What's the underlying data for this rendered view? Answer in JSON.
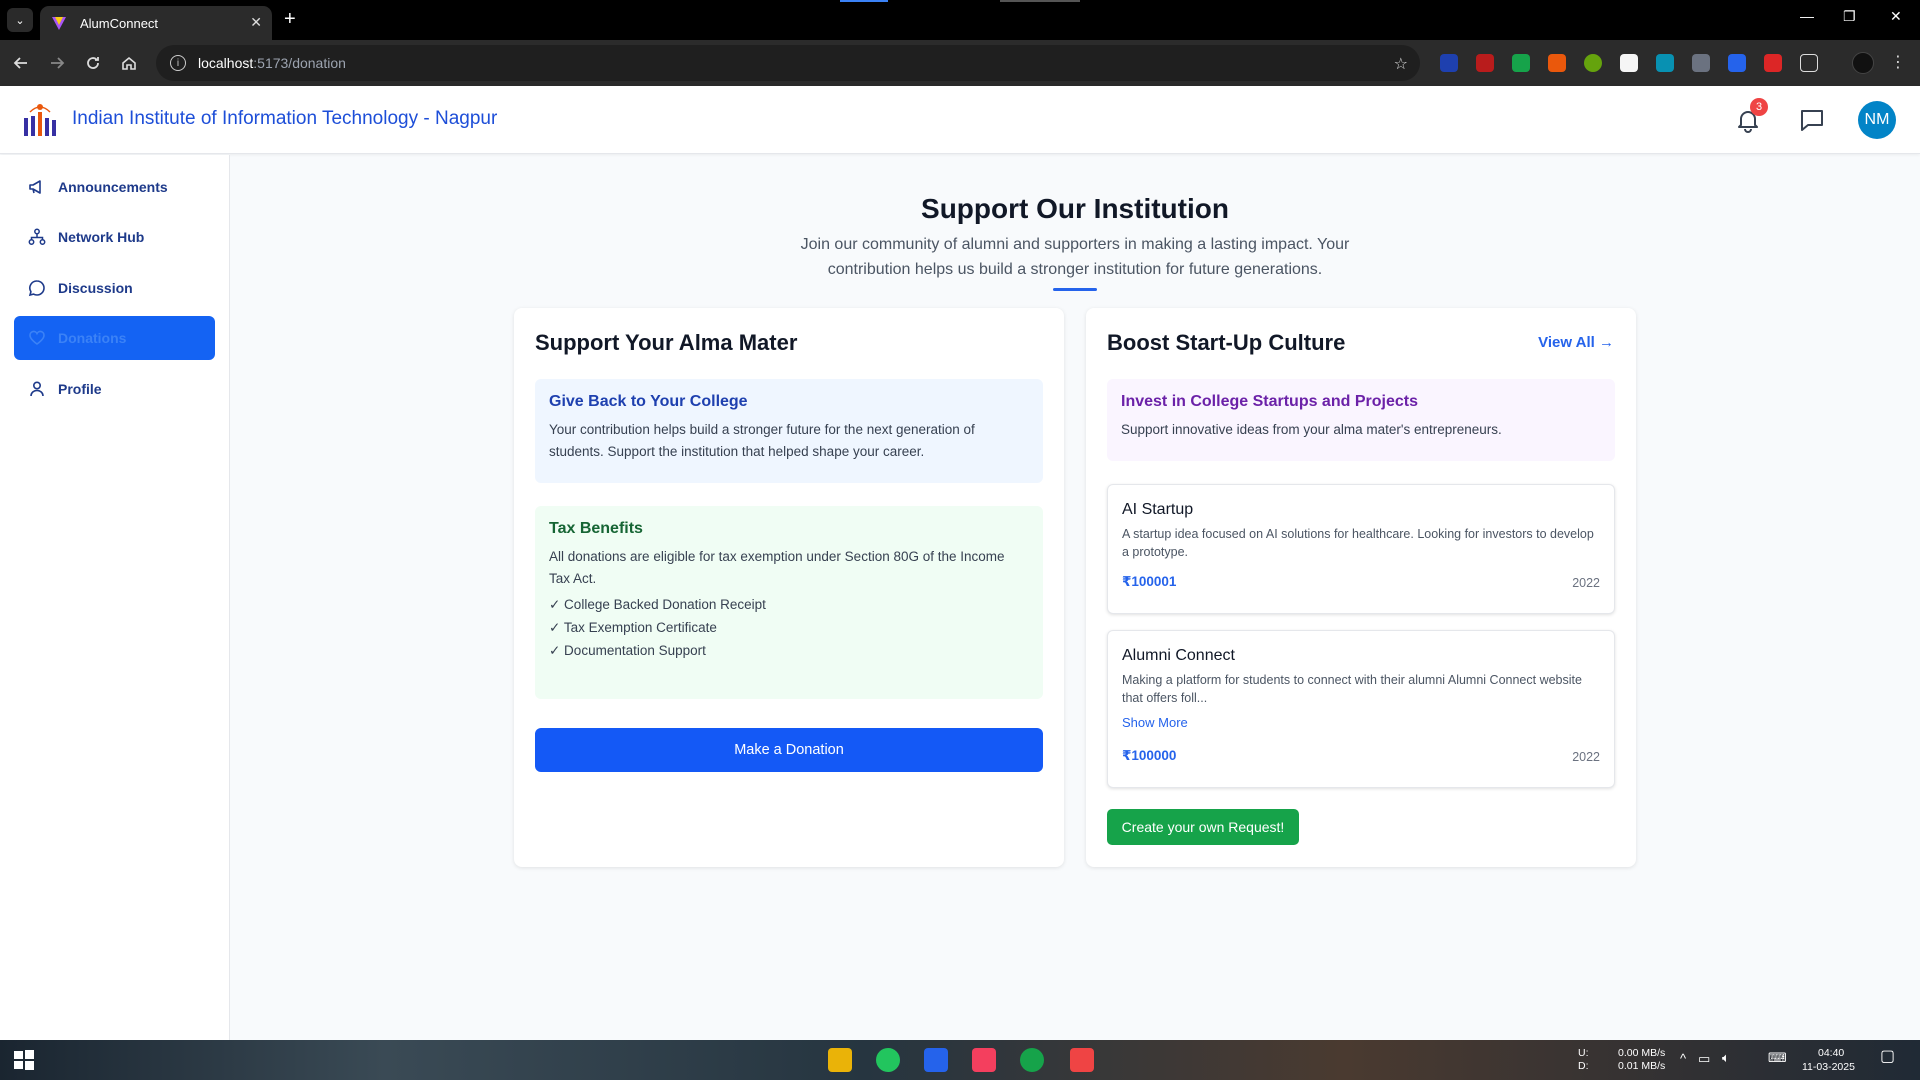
{
  "browser": {
    "tab_title": "AlumConnect",
    "url_host": "localhost",
    "url_path": ":5173/donation"
  },
  "header": {
    "institution": "Indian Institute of Information Technology - Nagpur",
    "notification_count": "3",
    "avatar_initials": "NM"
  },
  "sidebar": {
    "items": [
      {
        "label": "Announcements",
        "icon": "megaphone-icon"
      },
      {
        "label": "Network Hub",
        "icon": "network-icon"
      },
      {
        "label": "Discussion",
        "icon": "chat-bubble-icon"
      },
      {
        "label": "Donations",
        "icon": "heart-icon",
        "active": true
      },
      {
        "label": "Profile",
        "icon": "user-icon"
      }
    ]
  },
  "main": {
    "title": "Support Our Institution",
    "subtitle": "Join our community of alumni and supporters in making a lasting impact. Your contribution helps us build a stronger institution for future generations."
  },
  "left_card": {
    "title": "Support Your Alma Mater",
    "give_back": {
      "heading": "Give Back to Your College",
      "text": "Your contribution helps build a stronger future for the next generation of students. Support the institution that helped shape your career."
    },
    "tax": {
      "heading": "Tax Benefits",
      "text": "All donations are eligible for tax exemption under Section 80G of the Income Tax Act.",
      "items": [
        "✓ College Backed Donation Receipt",
        "✓ Tax Exemption Certificate",
        "✓ Documentation Support"
      ]
    },
    "donate_button": "Make a Donation"
  },
  "right_card": {
    "title": "Boost Start-Up Culture",
    "view_all": "View All →",
    "invest": {
      "heading": "Invest in College Startups and Projects",
      "text": "Support innovative ideas from your alma mater's entrepreneurs."
    },
    "projects": [
      {
        "title": "AI Startup",
        "description": "A startup idea focused on AI solutions for healthcare. Looking for investors to develop a prototype.",
        "amount": "₹100001",
        "year": "2022"
      },
      {
        "title": "Alumni Connect",
        "description": "Making a platform for students to connect with their alumni Alumni Connect website that offers foll...",
        "show_more": "Show More",
        "amount": "₹100000",
        "year": "2022"
      }
    ],
    "create_button": "Create your own Request!"
  },
  "taskbar": {
    "net_up_label": "U:",
    "net_down_label": "D:",
    "net_up": "0.00 MB/s",
    "net_down": "0.01 MB/s",
    "time": "04:40",
    "date": "11-03-2025"
  },
  "colors": {
    "primary": "#1459f6",
    "success": "#16a34a",
    "institution_blue": "#1d4ed8",
    "badge_red": "#ef4444"
  }
}
